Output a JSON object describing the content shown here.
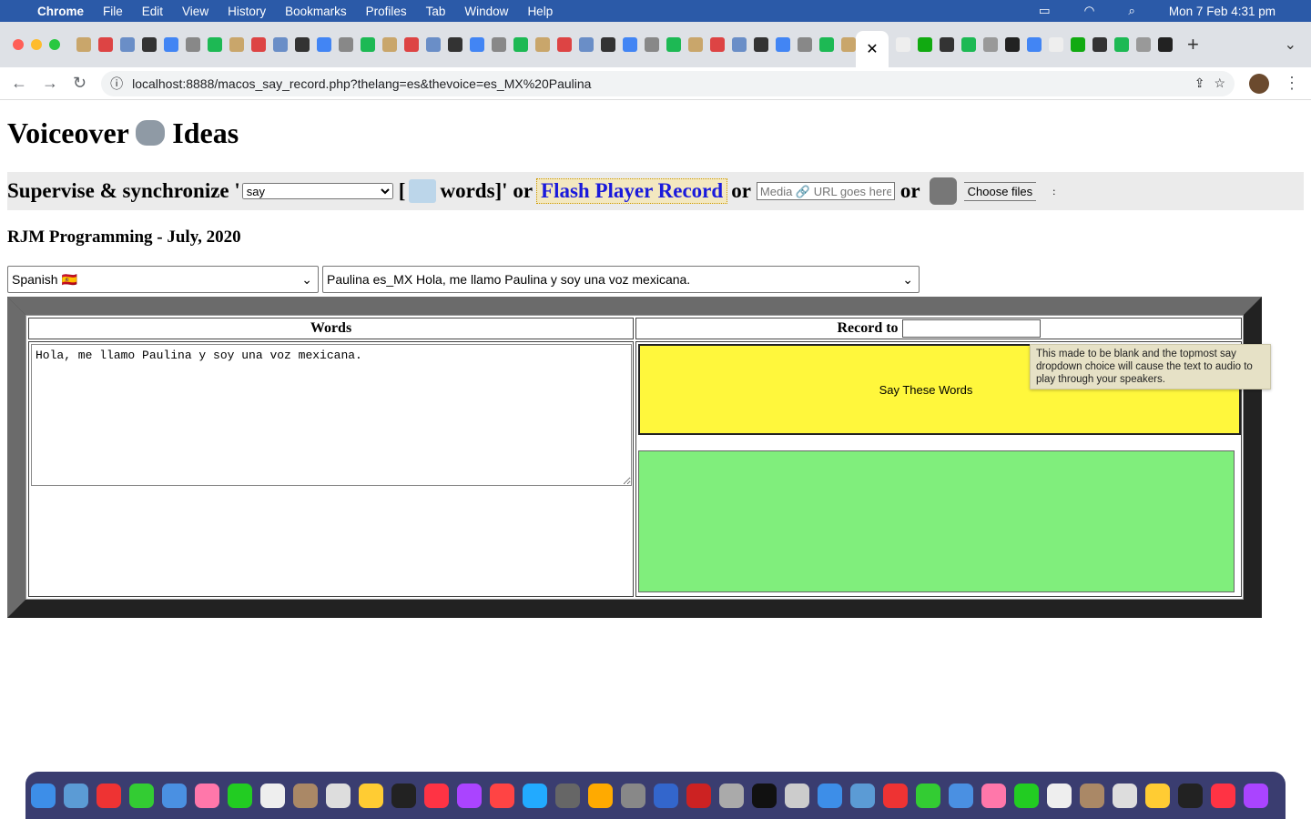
{
  "menubar": {
    "app": "Chrome",
    "items": [
      "File",
      "Edit",
      "View",
      "History",
      "Bookmarks",
      "Profiles",
      "Tab",
      "Window",
      "Help"
    ],
    "clock": "Mon 7 Feb  4:31 pm"
  },
  "browser": {
    "url": "localhost:8888/macos_say_record.php?thelang=es&thevoice=es_MX%20Paulina",
    "tab_close": "✕",
    "new_tab": "+"
  },
  "page": {
    "title": "Voiceover",
    "title2": "Ideas",
    "bar": {
      "prefix": "Supervise & synchronize '",
      "say_option": "say",
      "bracket": "[",
      "words": "words]' or",
      "flash": "Flash Player Record",
      "or1": "or",
      "media_placeholder": "Media 🔗 URL goes here",
      "or2": "or",
      "choose": "Choose files",
      "colon": ":"
    },
    "subtitle": "RJM Programming - July, 2020",
    "language": "Spanish 🇪🇸",
    "voice": "Paulina es_MX Hola, me llamo Paulina y soy una voz mexicana.",
    "words_header": "Words",
    "record_header": "Record to",
    "record_value": "",
    "textarea": "Hola, me llamo Paulina y soy una voz mexicana.",
    "say_button": "Say These Words",
    "tooltip": "This made to be blank and the topmost say dropdown choice will cause the text to audio to play through your speakers."
  },
  "colors": {
    "yellow": "#fff73c",
    "green": "#80ee7c",
    "frame": "#222222"
  }
}
